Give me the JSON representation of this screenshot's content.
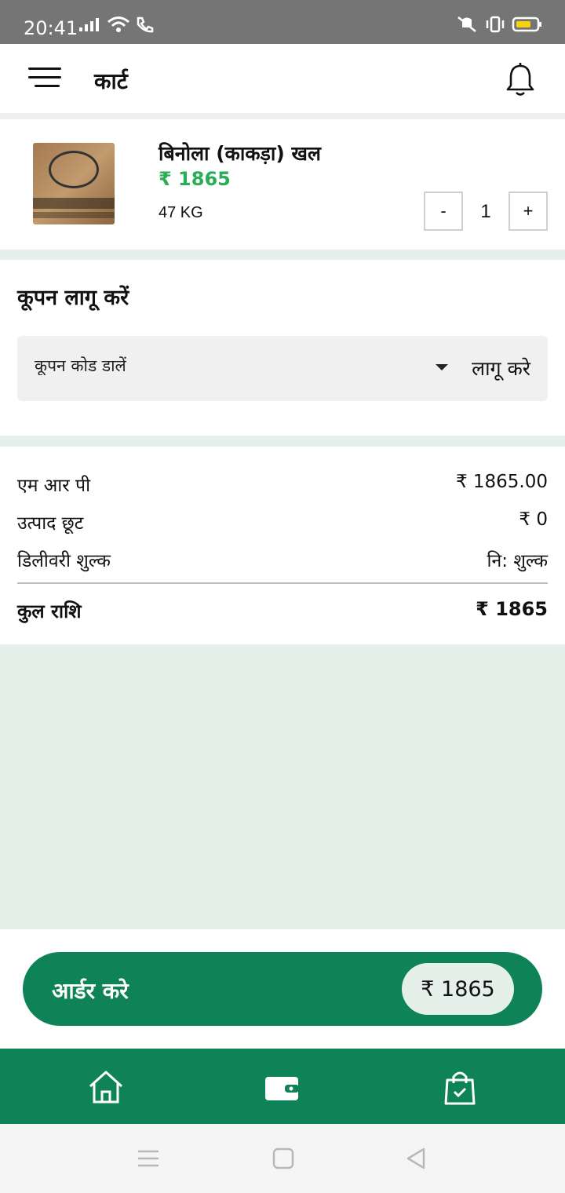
{
  "status_bar": {
    "time": "20:41"
  },
  "header": {
    "title": "कार्ट"
  },
  "cart_item": {
    "name": "बिनोला (काकड़ा) खल",
    "price": "₹ 1865",
    "weight": "47 KG",
    "quantity": "1",
    "minus_label": "-",
    "plus_label": "+"
  },
  "coupon": {
    "title": "कूपन लागू करें",
    "placeholder": "कूपन कोड डालें",
    "apply_label": "लागू करे"
  },
  "summary": {
    "mrp_label": "एम आर पी",
    "mrp_value": "₹ 1865.00",
    "discount_label": "उत्पाद छूट",
    "discount_value": "₹ 0",
    "delivery_label": "डिलीवरी शुल्क",
    "delivery_value": "नि: शुल्क",
    "total_label": "कुल राशि",
    "total_value": "₹ 1865"
  },
  "order_button": {
    "label": "आर्डर करे",
    "amount": "₹ 1865"
  },
  "colors": {
    "brand_green": "#0e8357",
    "price_green": "#2bad57",
    "page_bg": "#e5f0eb"
  },
  "bottom_nav": {
    "items": [
      "home-icon",
      "wallet-icon",
      "shopping-bag-icon"
    ]
  }
}
